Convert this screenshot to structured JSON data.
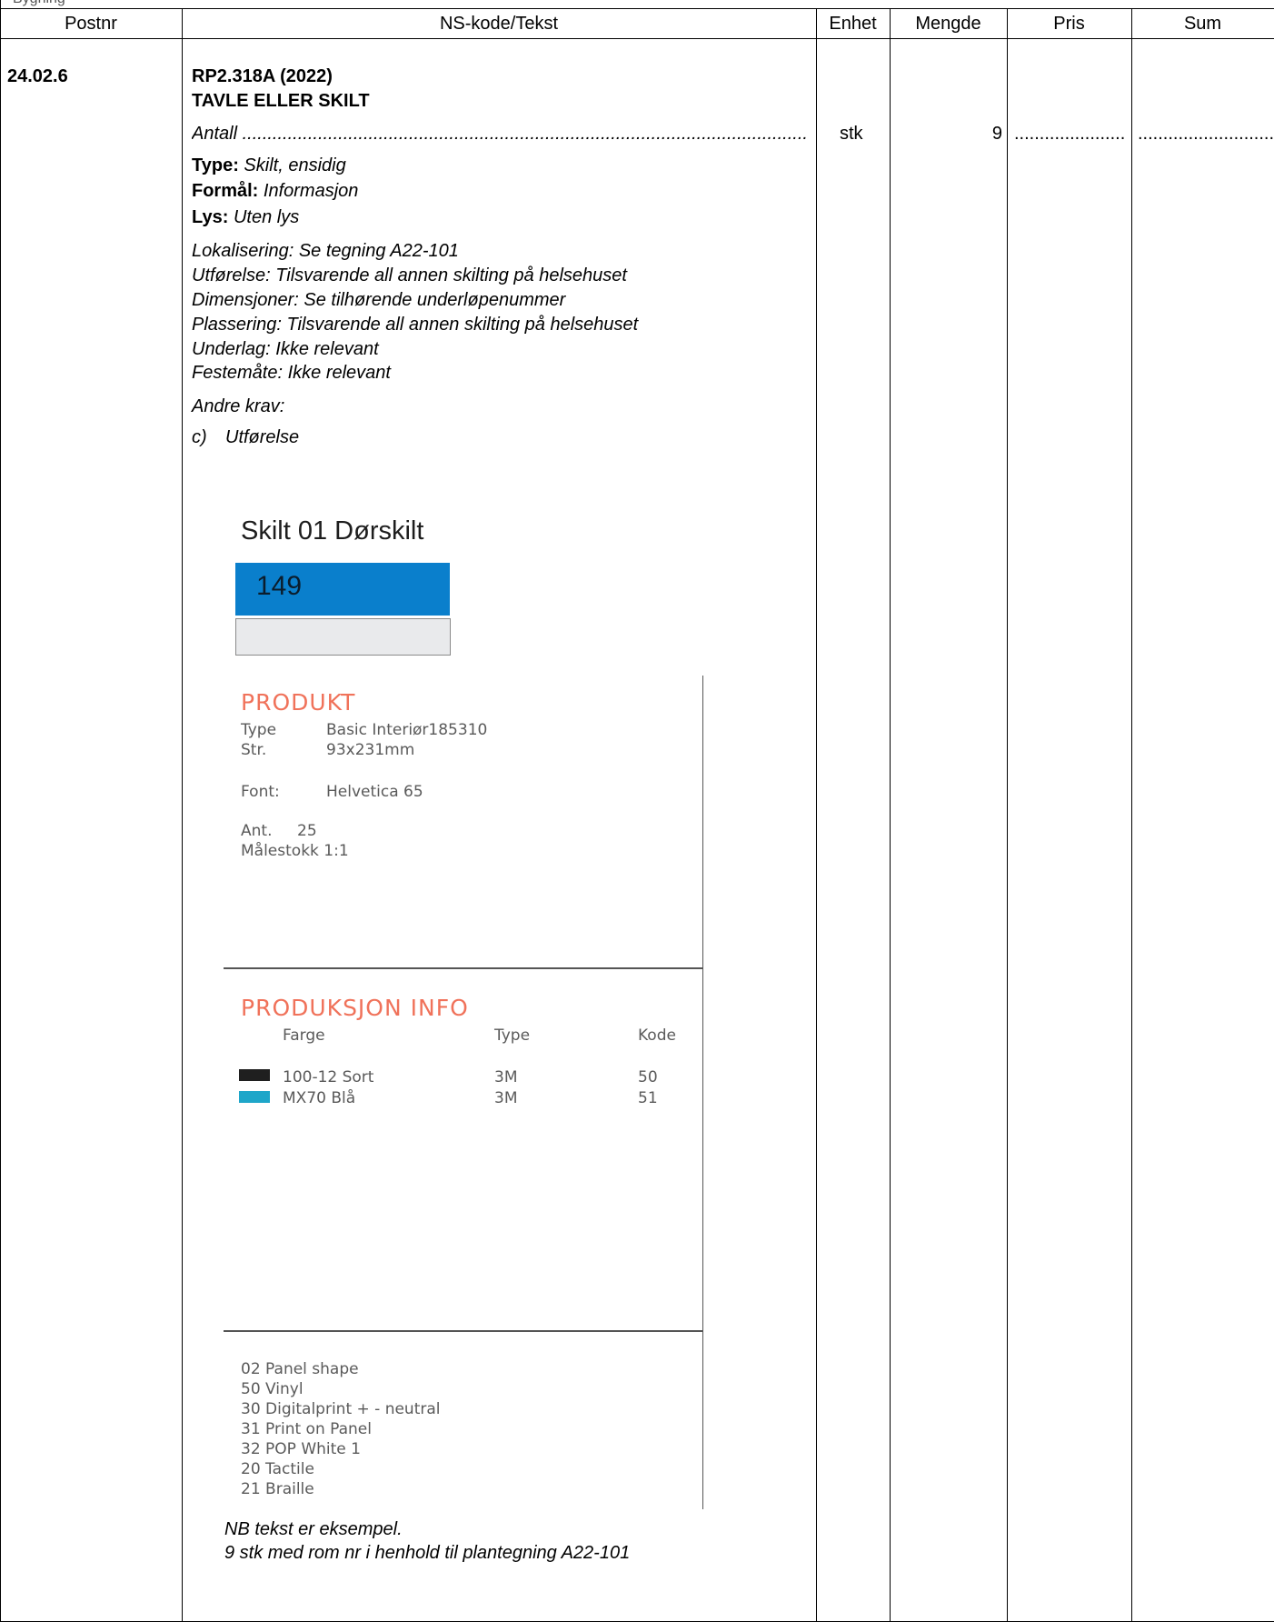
{
  "top_label": "Bygning",
  "table": {
    "headers": {
      "postnr": "Postnr",
      "tekst": "NS-kode/Tekst",
      "enhet": "Enhet",
      "mengde": "Mengde",
      "pris": "Pris",
      "sum": "Sum"
    }
  },
  "item": {
    "postnr": "24.02.6",
    "code": "RP2.318A (2022)",
    "title": "TAVLE ELLER SKILT",
    "antall_label": "Antall",
    "enhet": "stk",
    "mengde": "9",
    "type_label": "Type:",
    "type_value": "Skilt, ensidig",
    "formal_label": "Formål:",
    "formal_value": "Informasjon",
    "lys_label": "Lys:",
    "lys_value": "Uten lys",
    "details": [
      "Lokalisering: Se tegning A22-101",
      "Utførelse: Tilsvarende all annen skilting på helsehuset",
      "Dimensjoner: Se tilhørende underløpenummer",
      "Plassering: Tilsvarende all annen skilting på helsehuset",
      "Underlag: Ikke relevant",
      "Festemåte: Ikke relevant"
    ],
    "andre_krav": "Andre krav:",
    "c_label": "c)",
    "c_text": "Utførelse",
    "note1": "NB tekst er eksempel.",
    "note2": "9 stk med rom nr i henhold til plantegning A22-101"
  },
  "sign": {
    "title": "Skilt 01 Dørskilt",
    "number": "149",
    "number_bg": "#0a7fcc",
    "bottom_bg": "#e9eaec"
  },
  "produkt": {
    "heading": "PRODUKT",
    "rows": [
      {
        "label": "Type",
        "value": "Basic Interiør185310"
      },
      {
        "label": "Str.",
        "value": "93x231mm"
      },
      {
        "label": "Font:",
        "value": "Helvetica 65"
      },
      {
        "label": "Ant.",
        "value": "25"
      }
    ],
    "scale": "Målestokk 1:1"
  },
  "produksjon": {
    "heading": "PRODUKSJON INFO",
    "col_farge": "Farge",
    "col_type": "Type",
    "col_kode": "Kode",
    "rows": [
      {
        "color": "#1f1f1f",
        "farge": "100-12 Sort",
        "type": "3M",
        "kode": "50"
      },
      {
        "color": "#1ea6c9",
        "farge": "MX70 Blå",
        "type": "3M",
        "kode": "51"
      }
    ]
  },
  "features": [
    "02 Panel shape",
    "50 Vinyl",
    "30 Digitalprint + - neutral",
    "31 Print on Panel",
    "32 POP White 1",
    "20 Tactile",
    "21 Braille"
  ],
  "accent_red": "#f0725a"
}
